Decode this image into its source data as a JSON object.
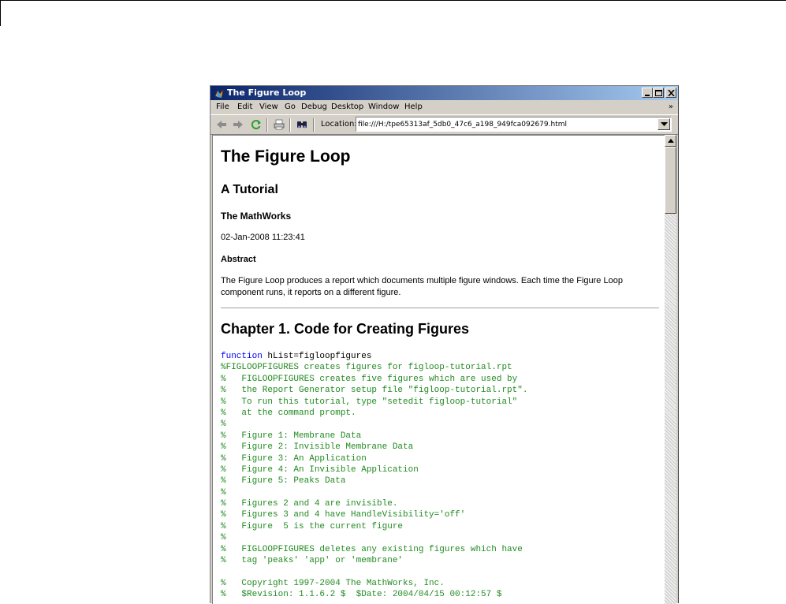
{
  "window": {
    "title": "The Figure Loop",
    "icon": "matlab-logo-icon"
  },
  "menu": {
    "items": [
      "File",
      "Edit",
      "View",
      "Go",
      "Debug",
      "Desktop",
      "Window",
      "Help"
    ],
    "overflow": "»"
  },
  "toolbar": {
    "buttons": [
      "back-arrow-icon",
      "forward-arrow-icon",
      "refresh-icon",
      "print-icon",
      "find-binoculars-icon"
    ],
    "location_label": "Location:",
    "location_value": "file:///H:/tpe65313af_5db0_47c6_a198_949fca092679.html"
  },
  "document": {
    "title": "The Figure Loop",
    "subtitle": "A Tutorial",
    "author": "The MathWorks",
    "date": "02-Jan-2008 11:23:41",
    "abstract_heading": "Abstract",
    "abstract_text": "The Figure Loop produces a report which documents multiple figure windows. Each time the Figure Loop component runs, it reports on a different figure.",
    "chapter_title": "Chapter 1. Code for Creating Figures",
    "code": {
      "keyword": "function",
      "signature": " hList=figloopfigures",
      "comments": [
        "%FIGLOOPFIGURES creates figures for figloop-tutorial.rpt",
        "%   FIGLOOPFIGURES creates five figures which are used by",
        "%   the Report Generator setup file \"figloop-tutorial.rpt\".",
        "%   To run this tutorial, type \"setedit figloop-tutorial\"",
        "%   at the command prompt.",
        "%",
        "%   Figure 1: Membrane Data",
        "%   Figure 2: Invisible Membrane Data",
        "%   Figure 3: An Application",
        "%   Figure 4: An Invisible Application",
        "%   Figure 5: Peaks Data",
        "%",
        "%   Figures 2 and 4 are invisible.",
        "%   Figures 3 and 4 have HandleVisibility='off'",
        "%   Figure  5 is the current figure",
        "%",
        "%   FIGLOOPFIGURES deletes any existing figures which have",
        "%   tag 'peaks' 'app' or 'membrane'",
        "",
        "%   Copyright 1997-2004 The MathWorks, Inc.",
        "%   $Revision: 1.1.6.2 $  $Date: 2004/04/15 00:12:57 $"
      ]
    }
  },
  "colors": {
    "titlebar_start": "#0a246a",
    "titlebar_end": "#a6caf0",
    "keyword": "#0000ff",
    "comment": "#228b22"
  }
}
